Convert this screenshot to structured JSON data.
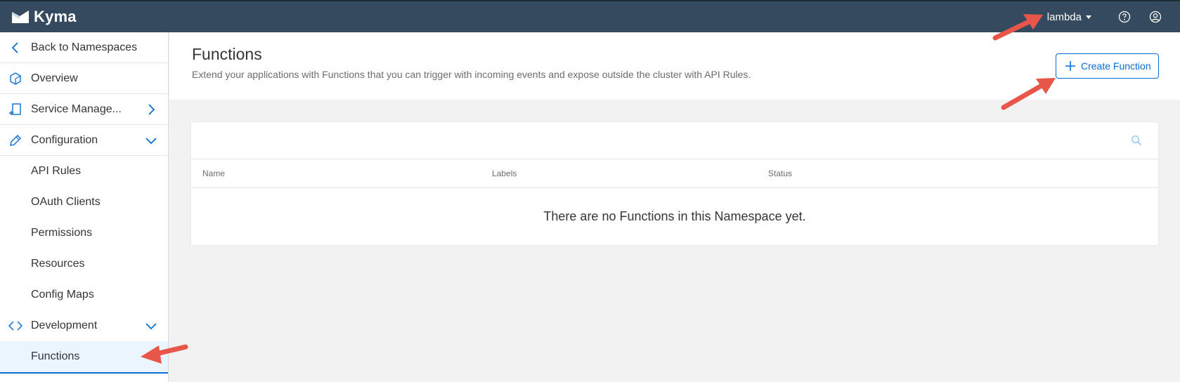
{
  "app": {
    "brand_name": "Kyma"
  },
  "topbar": {
    "namespace": "lambda"
  },
  "sidebar": {
    "items": [
      {
        "label": "Back to Namespaces"
      },
      {
        "label": "Overview"
      },
      {
        "label": "Service Manage..."
      },
      {
        "label": "Configuration"
      },
      {
        "label": "API Rules"
      },
      {
        "label": "OAuth Clients"
      },
      {
        "label": "Permissions"
      },
      {
        "label": "Resources"
      },
      {
        "label": "Config Maps"
      },
      {
        "label": "Development"
      },
      {
        "label": "Functions"
      }
    ]
  },
  "header": {
    "title": "Functions",
    "description": "Extend your applications with Functions that you can trigger with incoming events and expose outside the cluster with API Rules.",
    "create_label": "Create Function"
  },
  "table": {
    "columns": [
      "Name",
      "Labels",
      "Status"
    ],
    "empty_message": "There are no Functions in this Namespace yet."
  },
  "colors": {
    "shell": "#354a5f",
    "accent": "#0a6ed1",
    "annotation_arrow": "#e8564a"
  }
}
